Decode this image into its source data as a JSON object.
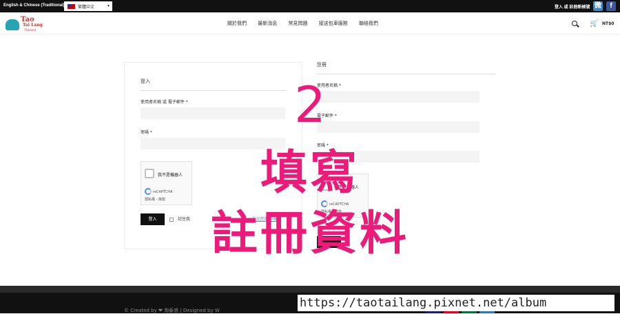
{
  "topbar": {
    "language_label": "English & Chinese (Traditional)",
    "language_selected": "繁體中文",
    "login_register": "登入 或 註冊新帳號",
    "weibo_icon_char": "微",
    "facebook_icon_char": "f"
  },
  "header": {
    "logo": {
      "line1": "Tao",
      "line2": "Tai Lang",
      "line3": "Thailand"
    },
    "nav": [
      "關於我們",
      "最新消息",
      "常見問題",
      "接送包車服務",
      "聯絡我們"
    ],
    "cart_total": "NT$0"
  },
  "login": {
    "title": "登入",
    "username_label": "使用者名稱 或 電子郵件 *",
    "password_label": "密碼 *",
    "captcha_text": "我不是機器人",
    "captcha_brand": "reCAPTCHA",
    "captcha_terms": "隱私權 - 條款",
    "submit_label": "登入",
    "remember_label": "記住我",
    "lost_password": "忘記您的密碼？"
  },
  "register": {
    "title": "註冊",
    "username_label": "使用者名稱 *",
    "email_label": "電子郵件 *",
    "password_label": "密碼 *",
    "captcha_text": "我不是機器人",
    "captcha_brand": "reCAPTCHA",
    "captcha_terms": "隱私權 - 條款"
  },
  "overlay": {
    "step_number": "2",
    "line1": "填寫",
    "line2": "註冊資料"
  },
  "footer": {
    "credit": "© Created by ❤ 淘泰浪 | Designed by W",
    "payments": [
      "VISA",
      "MC",
      "JCB",
      "AE"
    ]
  },
  "watermark": "https://taotailang.pixnet.net/album",
  "colors": {
    "overlay": "#ec1b7a",
    "topbar": "#111111",
    "field_bg": "#f4f4f4"
  }
}
